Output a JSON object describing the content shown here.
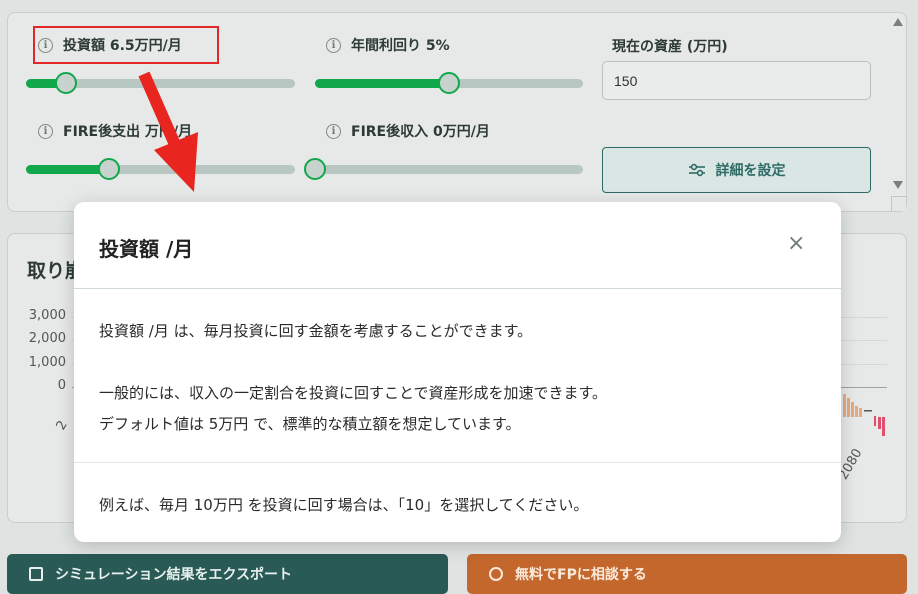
{
  "settings": {
    "investment_label": "投資額 6.5万円/月",
    "investment_level": 0.15,
    "yield_label": "年間利回り 5%",
    "yield_level": 0.5,
    "assets_label": "現在の資産 (万円)",
    "assets_value": "150",
    "fire_expense_label": "FIRE後支出 万円/月",
    "fire_expense_level": 0.31,
    "fire_income_label": "FIRE後収入 0万円/月",
    "fire_income_level": 0.0,
    "detail_button": "詳細を設定",
    "info_glyph": "i",
    "detail_icon": "sliders-icon"
  },
  "chart": {
    "title": "取り崩",
    "yticks": [
      "3,000",
      "2,000",
      "1,000",
      "0"
    ],
    "x_tick_partial": "2080"
  },
  "chart_data": {
    "type": "bar",
    "title": "取り崩",
    "yticks": [
      "3,000",
      "2,000",
      "1,000",
      "0"
    ],
    "x_ticks": [
      "2080"
    ]
  },
  "modal": {
    "title": "投資額 /月",
    "close": "×",
    "line1": "投資額 /月 は、毎月投資に回す金額を考慮することができます。",
    "line2": "一般的には、収入の一定割合を投資に回すことで資産形成を加速できます。",
    "line3": "デフォルト値は 5万円 で、標準的な積立額を想定しています。",
    "line4": "例えば、毎月 10万円 を投資に回す場合は、「10」を選択してください。"
  },
  "buttons": {
    "export": "シミュレーション結果をエクスポート",
    "consult": "無料でFPに相談する"
  },
  "colors": {
    "accent_green": "#11a84b",
    "dark_teal": "#2a5a56",
    "orange": "#c4672c",
    "highlight_red": "#e12727",
    "arrow_red": "#e8251f"
  }
}
